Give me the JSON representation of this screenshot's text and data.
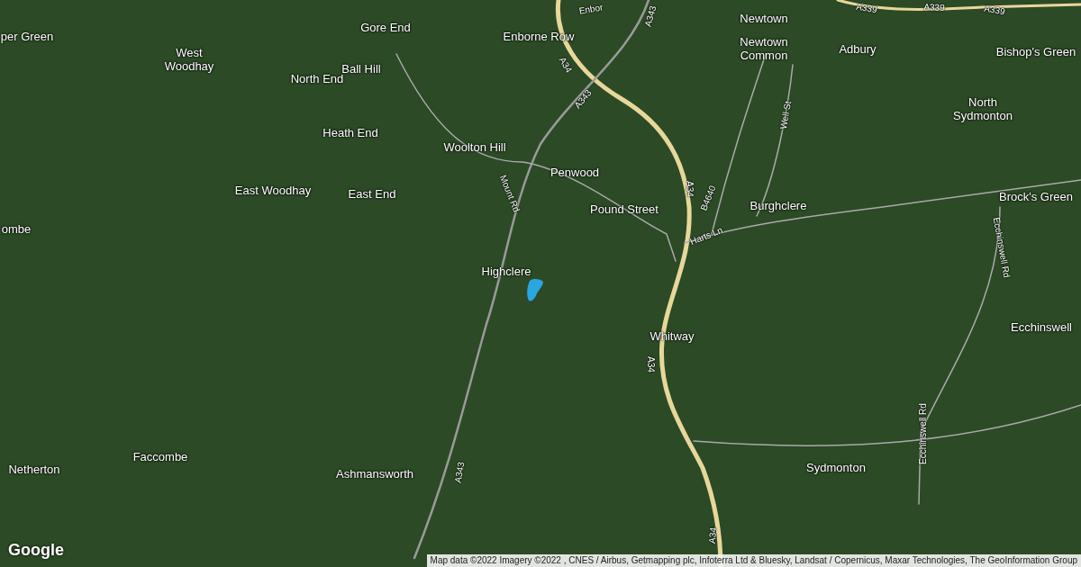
{
  "map": {
    "labels": [
      {
        "kind": "road",
        "text": "Enbor"
      },
      {
        "kind": "road",
        "text": "A343"
      },
      {
        "kind": "place",
        "text": "Newtown"
      },
      {
        "kind": "road",
        "text": "A339"
      },
      {
        "kind": "road",
        "text": "A339"
      },
      {
        "kind": "road",
        "text": "A339"
      },
      {
        "kind": "place",
        "text": "per Green"
      },
      {
        "kind": "place",
        "text": "West Woodhay"
      },
      {
        "kind": "place",
        "text": "Gore End"
      },
      {
        "kind": "place",
        "text": "Enborne Row"
      },
      {
        "kind": "place",
        "text": "Newtown Common"
      },
      {
        "kind": "place",
        "text": "Adbury"
      },
      {
        "kind": "place",
        "text": "Bishop's Green"
      },
      {
        "kind": "place",
        "text": "North End"
      },
      {
        "kind": "place",
        "text": "Ball Hill"
      },
      {
        "kind": "road",
        "text": "A34"
      },
      {
        "kind": "place",
        "text": "Heath End"
      },
      {
        "kind": "road",
        "text": "A343"
      },
      {
        "kind": "road",
        "text": "Well St"
      },
      {
        "kind": "place",
        "text": "North Sydmonton"
      },
      {
        "kind": "place",
        "text": "Woolton Hill"
      },
      {
        "kind": "place",
        "text": "Penwood"
      },
      {
        "kind": "place",
        "text": "East Woodhay"
      },
      {
        "kind": "place",
        "text": "East End"
      },
      {
        "kind": "road",
        "text": "Mount Rd"
      },
      {
        "kind": "place",
        "text": "Pound Street"
      },
      {
        "kind": "road",
        "text": "A34"
      },
      {
        "kind": "road",
        "text": "B4640"
      },
      {
        "kind": "place",
        "text": "Burghclere"
      },
      {
        "kind": "place",
        "text": "Brock's Green"
      },
      {
        "kind": "place",
        "text": "ombe"
      },
      {
        "kind": "road",
        "text": "Harts Ln"
      },
      {
        "kind": "road",
        "text": "Ecchinswell Rd"
      },
      {
        "kind": "place",
        "text": "Highclere"
      },
      {
        "kind": "place",
        "text": "Whitway"
      },
      {
        "kind": "place",
        "text": "Ecchinswell"
      },
      {
        "kind": "road",
        "text": "A34"
      },
      {
        "kind": "road",
        "text": "Ecchinswell Rd"
      },
      {
        "kind": "place",
        "text": "Netherton"
      },
      {
        "kind": "place",
        "text": "Faccombe"
      },
      {
        "kind": "place",
        "text": "Ashmansworth"
      },
      {
        "kind": "road",
        "text": "A343"
      },
      {
        "kind": "place",
        "text": "Sydmonton"
      },
      {
        "kind": "road",
        "text": "A34"
      }
    ]
  },
  "logo": "Google",
  "attribution": "Map data ©2022 Imagery ©2022 , CNES / Airbus, Getmapping plc, Infoterra Ltd & Bluesky, Landsat / Copernicus, Maxar Technologies, The GeoInformation Group"
}
